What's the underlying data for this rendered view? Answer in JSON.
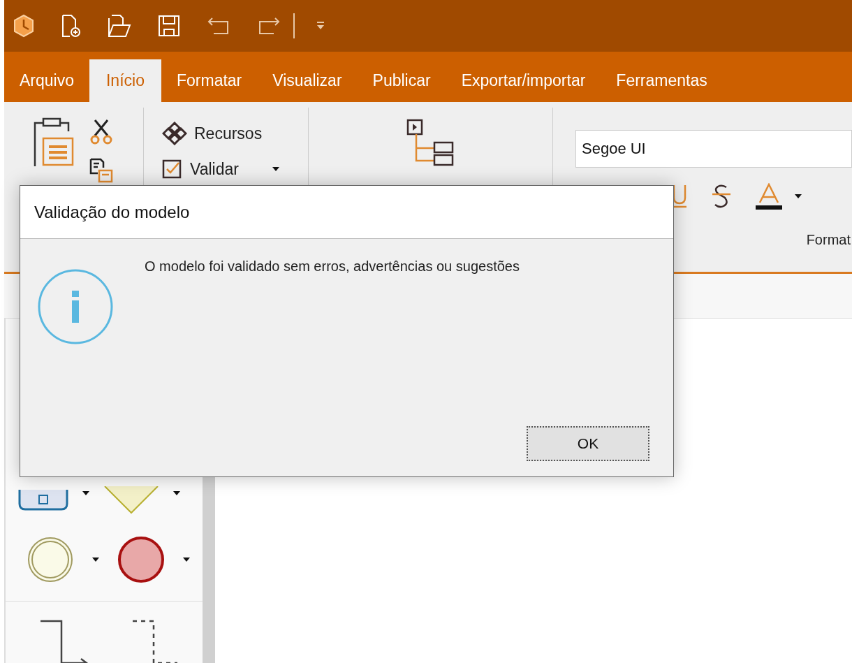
{
  "tabs": [
    {
      "label": "Arquivo",
      "selected": false
    },
    {
      "label": "Início",
      "selected": true
    },
    {
      "label": "Formatar",
      "selected": false
    },
    {
      "label": "Visualizar",
      "selected": false
    },
    {
      "label": "Publicar",
      "selected": false
    },
    {
      "label": "Exportar/importar",
      "selected": false
    },
    {
      "label": "Ferramentas",
      "selected": false
    }
  ],
  "ribbon": {
    "resources_button": "Recursos",
    "validate_button": "Validar",
    "font_field": {
      "value": "Segoe UI"
    },
    "group_label": "Format"
  },
  "dialog": {
    "title": "Validação do modelo",
    "message": "O modelo foi validado sem erros, advertências ou sugestões",
    "ok_button": "OK"
  }
}
